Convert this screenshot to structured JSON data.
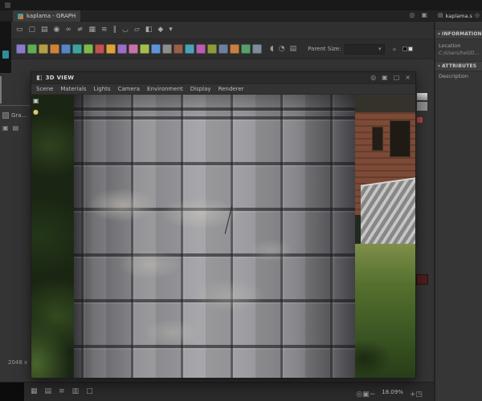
{
  "app": {
    "titlebar": {
      "tab_label": "kaplama - GRAPH",
      "right_icons": [
        {
          "name": "pin-icon",
          "glyph": "◎"
        },
        {
          "name": "layout-icon",
          "glyph": "▣"
        }
      ]
    },
    "toolbar_main": {
      "icons": [
        {
          "name": "select-icon",
          "glyph": "▭"
        },
        {
          "name": "frame-icon",
          "glyph": "▢"
        },
        {
          "name": "comment-icon",
          "glyph": "▤"
        },
        {
          "name": "pin-note-icon",
          "glyph": "◉"
        },
        {
          "name": "link-mode-icon",
          "glyph": "∞"
        },
        {
          "name": "unlink-icon",
          "glyph": "≠"
        },
        {
          "name": "grid-snap-icon",
          "glyph": "▦"
        },
        {
          "name": "align-horizontal-icon",
          "glyph": "≡"
        },
        {
          "name": "align-vertical-icon",
          "glyph": "∥"
        },
        {
          "name": "magnet-icon",
          "glyph": "◡"
        },
        {
          "name": "draw-icon",
          "glyph": "▱"
        },
        {
          "name": "material-mode-icon",
          "glyph": "◧"
        },
        {
          "name": "compute-icon",
          "glyph": "◆"
        },
        {
          "name": "toolbar-options-icon",
          "glyph": "▾"
        }
      ]
    },
    "toolbar_nodes": {
      "palette": [
        "#8a7cc8",
        "#5fae57",
        "#b0a04a",
        "#d2813a",
        "#5486c6",
        "#3fa39b",
        "#7fb94e",
        "#c25252",
        "#d9a43b",
        "#9b6fc2",
        "#c873a6",
        "#a4bd4f",
        "#6093d6",
        "#8d8d8d",
        "#96604a",
        "#4aa3b5",
        "#b95fb2",
        "#8d9b3e",
        "#6f7f9f",
        "#c77f43",
        "#57a06b",
        "#7d8d9d"
      ],
      "extra_icons": [
        {
          "name": "speaker-icon",
          "glyph": "◖"
        },
        {
          "name": "bell-icon",
          "glyph": "◔"
        },
        {
          "name": "layers-icon",
          "glyph": "▤"
        }
      ],
      "parent_size_label": "Parent Size:",
      "select_chevron": "▾",
      "more_glyph": "»"
    },
    "left_panel": {
      "graph_tab_label": "Gra...",
      "tab_icons": [
        {
          "name": "graph-list-icon",
          "glyph": "▣"
        },
        {
          "name": "folder-icon",
          "glyph": "▤"
        }
      ],
      "resolution_label": "2048 x"
    },
    "bottombar": {
      "left_icons": [
        {
          "name": "grid-view-icon",
          "glyph": "▦"
        },
        {
          "name": "thumbnail-view-icon",
          "glyph": "▤"
        },
        {
          "name": "list-view-icon",
          "glyph": "≡"
        },
        {
          "name": "compact-view-icon",
          "glyph": "▥"
        },
        {
          "name": "preview-icon",
          "glyph": "□"
        }
      ],
      "right_icons_pre": [
        {
          "name": "focus-icon",
          "glyph": "◎"
        },
        {
          "name": "fit-view-icon",
          "glyph": "▣"
        },
        {
          "name": "zoom-out-icon",
          "glyph": "−"
        }
      ],
      "zoom_label": "18.09%",
      "right_icons_post": [
        {
          "name": "zoom-in-icon",
          "glyph": "+"
        },
        {
          "name": "fullscreen-icon",
          "glyph": "◳"
        }
      ]
    }
  },
  "view3d": {
    "title": "3D VIEW",
    "cube_glyph": "◧",
    "window_icons": [
      {
        "name": "pin-icon",
        "glyph": "◎"
      },
      {
        "name": "dock-icon",
        "glyph": "▣"
      },
      {
        "name": "maximize-icon",
        "glyph": "□"
      },
      {
        "name": "close-icon",
        "glyph": "×"
      }
    ],
    "menu": [
      "Scene",
      "Materials",
      "Lights",
      "Camera",
      "Environment",
      "Display",
      "Renderer"
    ],
    "viewport_icons": [
      {
        "name": "display-toggle-icon",
        "glyph": "▣",
        "color": "#cfcfcf"
      },
      {
        "name": "light-bulb-icon",
        "glyph": "●",
        "color": "#d8c86a"
      }
    ]
  },
  "right_panel": {
    "tab_label": "kaplama.sbs",
    "pin_glyph": "◎",
    "doc_icon_glyph": "▤",
    "chevron": "▾",
    "info_header": "INFORMATION",
    "location_label": "Location",
    "location_value": "C:/Users/hell/Desktop",
    "attributes_header": "ATTRIBUTES",
    "description_label": "Description"
  },
  "colors": {
    "accent_teal": "#2e8f96",
    "panel_bg": "#343434",
    "titlebar_bg": "#232323",
    "stone_grey": "#9a9a9e",
    "brick_wall": "#7c4a36",
    "grass_green": "#55702e"
  }
}
